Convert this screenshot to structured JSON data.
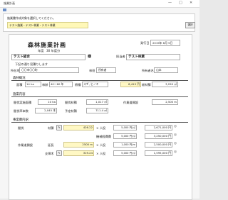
{
  "window": {
    "title": "施業計画",
    "minimize": "—",
    "maximize": "□",
    "close": "✕"
  },
  "prompt": {
    "message": "施業書作成対象を選択してください。",
    "selected": "テスト施業・テスト林業・テスト林業",
    "button": "選択"
  },
  "sheet": {
    "title": "森林施業計画",
    "date_label": "発行日",
    "date_value": "2019年 6月 5日",
    "year_label": "年度",
    "year_value": "30 年度分",
    "client_value": "テスト組合",
    "honorific": "様",
    "author_label": "担当者",
    "author_value": "テスト林業",
    "field_label": "下記の通り見積りします",
    "location_value": "〇〇市〇〇町",
    "owner_label": "林班",
    "owner_value": "所有者",
    "owner_name_label": "所有者名",
    "owner_name_value": "山本",
    "sect_forest": "森林概況",
    "forest": {
      "area_label": "面積",
      "area_value": "14 ha",
      "age_label": "林齢",
      "age_value": "40〜60 年",
      "species_label": "樹種",
      "species_value": "スギ, ヒノキ",
      "unit_cost_value": "8,415 円",
      "total_label": "総材積",
      "total_value": "3,290 ㎥"
    },
    "sect_work": "施業内容",
    "work": {
      "row1_label": "間伐実施面積",
      "row1_value": "10 ha",
      "row1b_label": "間伐材積",
      "row1b_value": "1,017 ㎥",
      "row1c_label": "作業道開設",
      "row1c_value": "2,500 m",
      "row2_label": "間伐率本数",
      "row2_value": "2,045 本",
      "row2b_label": "予定材積",
      "row2b_value": "711.4 ㎥"
    },
    "sect_cost": "事業費内訳",
    "cost_rows": [
      {
        "label": "間伐",
        "unit_label": "材積",
        "qty": "426.22",
        "x": "× 人役",
        "price": "5,000 円/㎥",
        "total": "2,671,000 円"
      },
      {
        "label": "",
        "unit_label": "",
        "qty": "",
        "x": "機械経費費",
        "price": "5,000 円/㎥",
        "total": "3,250,000 円"
      },
      {
        "label": "作業道開設",
        "unit_label": "延長",
        "qty": "2500 m",
        "x": "× 人役",
        "price": "1,000 円/m",
        "total": "2,500,000 円"
      },
      {
        "label": "",
        "unit_label": "支障木",
        "qty": "319.24",
        "x": "× 人役",
        "price": "5,000 円/㎥",
        "total": "1,595,000 円"
      }
    ]
  }
}
